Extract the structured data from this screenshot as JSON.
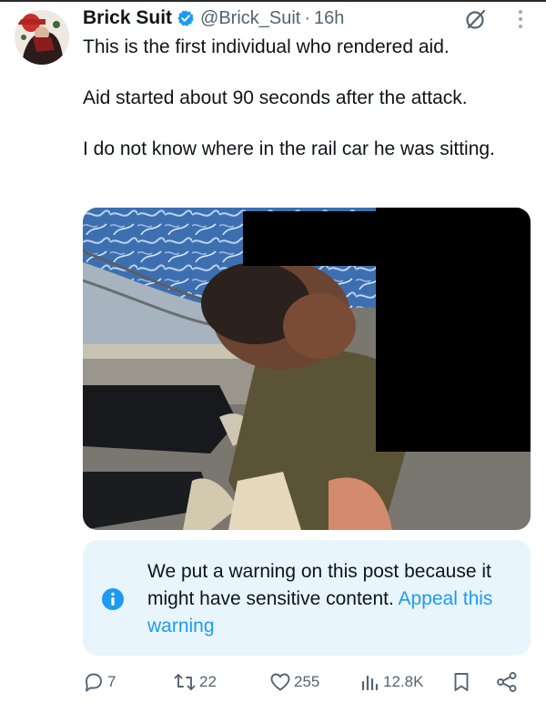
{
  "post": {
    "display_name": "Brick Suit",
    "handle": "@Brick_Suit",
    "separator": "·",
    "time": "16h",
    "verified_icon": "verified-badge-icon",
    "paragraphs": [
      "This is the first individual who rendered aid.",
      "Aid started about 90 seconds after the attack.",
      "I do not know where in the rail car he was sitting."
    ]
  },
  "warning": {
    "message": "We put a warning on this post because it might have sensitive content.",
    "link_label": "Appeal this warning"
  },
  "actions": {
    "replies": "7",
    "reposts": "22",
    "likes": "255",
    "views": "12.8K"
  },
  "icons": {
    "grok": "grok-icon",
    "more": "more-vertical-icon",
    "reply": "reply-icon",
    "repost": "repost-icon",
    "like": "heart-icon",
    "views": "views-icon",
    "bookmark": "bookmark-icon",
    "share": "share-icon",
    "info": "info-icon"
  },
  "colors": {
    "accent": "#1d9bf0",
    "text": "#0f1419",
    "secondary": "#536471",
    "warning_bg": "#e8f5fd"
  }
}
